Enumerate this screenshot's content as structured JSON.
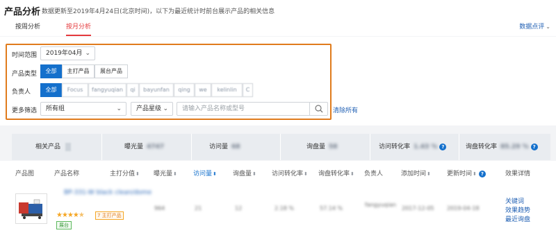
{
  "header": {
    "title": "产品分析",
    "update_note": "数据更新至2019年4月24日(北京时间)，以下为最近统计时前台展示产品的相关信息",
    "tabs": [
      "按周分析",
      "按月分析"
    ],
    "rating_link": "数据点评"
  },
  "filters": {
    "time_label": "时间范围",
    "time_value": "2019年04月",
    "type_label": "产品类型",
    "type_options": [
      "全部",
      "主打产品",
      "展台产品"
    ],
    "owner_label": "负责人",
    "owner_options": [
      "全部",
      "Focus",
      "fangyuqian",
      "qi",
      "bayunfan",
      "qing",
      "we",
      "kelinlin",
      "C"
    ],
    "more_label": "更多筛选",
    "group_value": "所有组",
    "star_value": "产品星级",
    "search_placeholder": "请输入产品名称或型号",
    "clear_all": "清除所有"
  },
  "stats": {
    "related_label": "相关产品",
    "exposure_label": "曝光量",
    "exposure_value": "4747",
    "visits_label": "访问量",
    "visits_value": "68",
    "inquiry_label": "询盘量",
    "inquiry_value": "58",
    "visit_rate_label": "访问转化率",
    "visit_rate_value": "1.43 %",
    "inquiry_rate_label": "询盘转化率",
    "inquiry_rate_value": "85.29 %"
  },
  "table": {
    "headers": [
      "产品图",
      "产品名称",
      "主打分值",
      "曝光量",
      "访问量",
      "询盘量",
      "访问转化率",
      "询盘转化率",
      "负责人",
      "添加时间",
      "更新时间",
      "效果详情"
    ],
    "row": {
      "name": "BP-331-W black clean/dome",
      "badge_main": "7 主打产品",
      "badge_show": "展台",
      "exposure": "964",
      "visits": "21",
      "inquiry": "12",
      "visit_rate": "2.18 %",
      "inquiry_rate": "57.14 %",
      "owner": "fangyuqian",
      "added": "2017-12-05",
      "updated": "2019-04-18",
      "links": [
        "关键词",
        "效果趋势",
        "最近询盘"
      ]
    }
  },
  "colors": {
    "accent": "#1470cc",
    "active_tab": "#e4393c",
    "highlight": "#e07b1c",
    "link": "#1f5fb3",
    "star": "#f5a623"
  }
}
